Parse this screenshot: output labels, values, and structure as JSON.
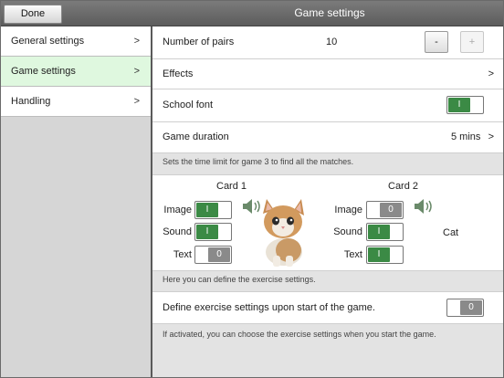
{
  "toolbar": {
    "done_label": "Done",
    "title": "Game settings"
  },
  "sidebar": {
    "items": [
      {
        "label": "General settings",
        "chevron": ">"
      },
      {
        "label": "Game settings",
        "chevron": ">"
      },
      {
        "label": "Handling",
        "chevron": ">"
      }
    ]
  },
  "settings": {
    "pairs": {
      "label": "Number of pairs",
      "value": "10",
      "minus_label": "-",
      "plus_label": "+"
    },
    "effects": {
      "label": "Effects",
      "chevron": ">"
    },
    "school_font": {
      "label": "School font",
      "toggle_text": "I",
      "enabled": true
    },
    "duration": {
      "label": "Game duration",
      "value": "5 mins",
      "chevron": ">"
    },
    "duration_hint": "Sets the time limit for game 3 to find all the matches."
  },
  "cards": {
    "card1": {
      "title": "Card 1",
      "image_label": "Image",
      "image_toggle": "I",
      "sound_label": "Sound",
      "sound_toggle": "I",
      "text_label": "Text",
      "text_toggle": "0"
    },
    "card2": {
      "title": "Card 2",
      "image_label": "Image",
      "image_toggle": "0",
      "sound_label": "Sound",
      "sound_toggle": "I",
      "text_label": "Text",
      "text_toggle": "I",
      "word": "Cat"
    },
    "hint": "Here you can define the exercise settings."
  },
  "exercise": {
    "label": "Define exercise settings upon start of the game.",
    "toggle_text": "0",
    "enabled": false,
    "hint": "If activated, you can choose the exercise settings when you start the game."
  },
  "colors": {
    "toggle_on": "#3b8a45",
    "toggle_off": "#8a8a8a",
    "active_sidebar": "#dff8df"
  },
  "icons": [
    "speaker-icon",
    "kitten-image"
  ]
}
